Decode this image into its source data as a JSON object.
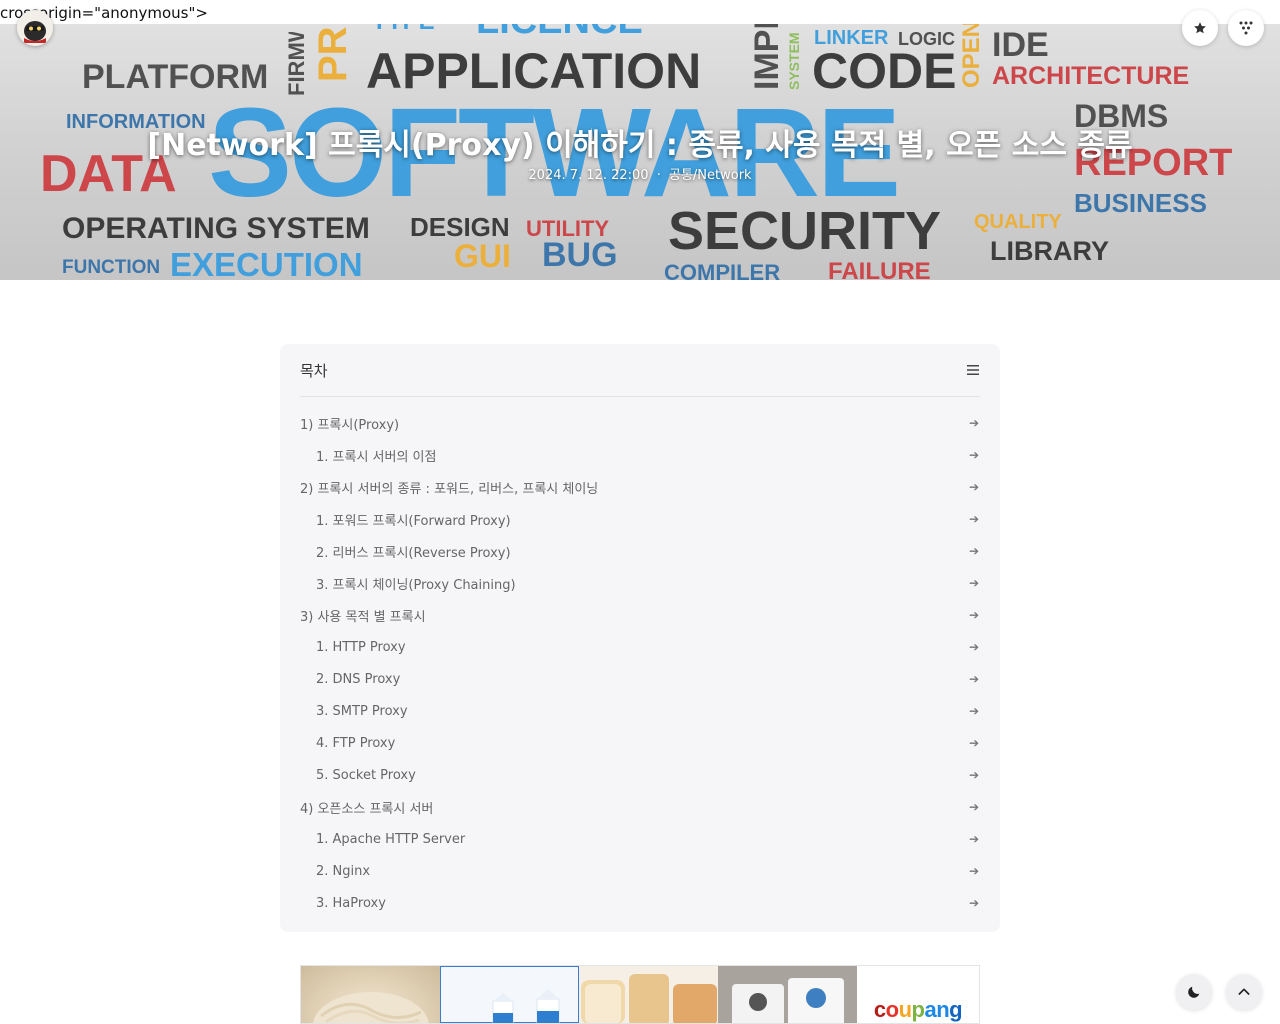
{
  "stray_text": "crossorigin=\"anonymous\">",
  "post": {
    "title": "[Network] 프록시(Proxy) 이해하기 : 종류, 사용 목적 별, 오픈 소스 종류",
    "date": "2024. 7. 12. 22:00",
    "separator": "·",
    "category": "공통/Network"
  },
  "hero_words": [
    "PLATFORM",
    "FIRMWARE",
    "PR",
    "TYPE",
    "LICENCE",
    "APPLICATION",
    "IMPL",
    "SYSTEM",
    "LINKER",
    "LOGIC",
    "CODE",
    "OPEN",
    "IDE",
    "ARCHITECTURE",
    "INFORMATION",
    "DATA",
    "SOFTWARE",
    "DBMS",
    "REPORT",
    "BUSINESS",
    "OPERATING SYSTEM",
    "DESIGN",
    "UTILITY",
    "SECURITY",
    "QUALITY",
    "LIBRARY",
    "FUNCTION",
    "EXECUTION",
    "GUI",
    "BUG",
    "COMPILER",
    "FAILURE"
  ],
  "icons": {
    "avatar": "avatar-icon",
    "bookmark": "star-icon",
    "menu": "grid-dots-icon",
    "toc_toggle": "hamburger-icon",
    "dark_mode": "moon-icon",
    "scroll_top": "chevron-up-icon",
    "toc_arrow": "arrow-right-icon"
  },
  "toc": {
    "title": "목차",
    "items": [
      {
        "label": "1) 프록시(Proxy)",
        "level": 1
      },
      {
        "label": "1. 프록시 서버의 이점",
        "level": 2
      },
      {
        "label": "2) 프록시 서버의 종류 : 포워드, 리버스, 프록시 체이닝",
        "level": 1
      },
      {
        "label": "1. 포워드 프록시(Forward Proxy)",
        "level": 2
      },
      {
        "label": "2. 리버스 프록시(Reverse Proxy)",
        "level": 2
      },
      {
        "label": "3. 프록시 체이닝(Proxy Chaining)",
        "level": 2
      },
      {
        "label": "3) 사용 목적 별 프록시",
        "level": 1
      },
      {
        "label": "1. HTTP Proxy",
        "level": 2
      },
      {
        "label": "2. DNS Proxy",
        "level": 2
      },
      {
        "label": "3. SMTP Proxy",
        "level": 2
      },
      {
        "label": "4. FTP Proxy",
        "level": 2
      },
      {
        "label": "5. Socket Proxy",
        "level": 2
      },
      {
        "label": "4) 오픈소스 프록시 서버",
        "level": 1
      },
      {
        "label": "1. Apache HTTP Server",
        "level": 2
      },
      {
        "label": "2. Nginx",
        "level": 2
      },
      {
        "label": "3. HaProxy",
        "level": 2
      }
    ]
  },
  "ad": {
    "logo_text": "coupang",
    "logo_colors": [
      "#b31d1a",
      "#e6332a",
      "#f5a623",
      "#7cb342",
      "#1e88e5",
      "#1e88e5",
      "#1565c0"
    ]
  },
  "colors": {
    "software_blue": "#1f8fd6",
    "data_red": "#c4262b",
    "accent_blue": "#3a7bd5"
  }
}
